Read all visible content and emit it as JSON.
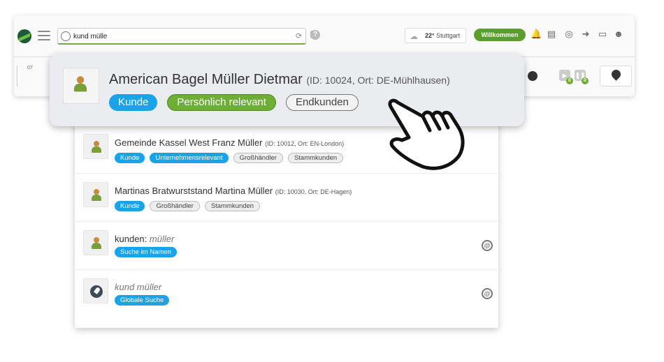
{
  "toolbar": {
    "search_value": "kund mülle",
    "help_label": "?",
    "weather_temp": "22°",
    "weather_city": "Stuttgart",
    "welcome_label": "Willkommen",
    "day_label": "07",
    "badge_a": "0",
    "badge_b": "0"
  },
  "highlight": {
    "name": "American Bagel Müller Dietmar",
    "meta": "(ID: 10024, Ort: DE-Mühlhausen)",
    "tags": [
      "Kunde",
      "Persönlich relevant",
      "Endkunden"
    ]
  },
  "results": [
    {
      "name": "Gemeinde Kassel West Franz Müller",
      "meta": "(ID: 10012, Ort: EN-London)",
      "tags": [
        "Kunde",
        "Unternehmensrelevant",
        "Großhändler",
        "Stammkunden"
      ]
    },
    {
      "name": "Martinas Bratwurststand Martina Müller",
      "meta": "(ID: 10030, Ort: DE-Hagen)",
      "tags": [
        "Kunde",
        "Großhändler",
        "Stammkunden"
      ]
    },
    {
      "prefix": "kunden:",
      "query": "müller",
      "tags": [
        "Suche im Namen"
      ]
    },
    {
      "query": "kund müller",
      "tags": [
        "Globale Suche"
      ]
    }
  ],
  "icons": {
    "at": "@"
  },
  "colors": {
    "accent_green": "#6fae35",
    "tag_blue": "#1aa3e8"
  }
}
